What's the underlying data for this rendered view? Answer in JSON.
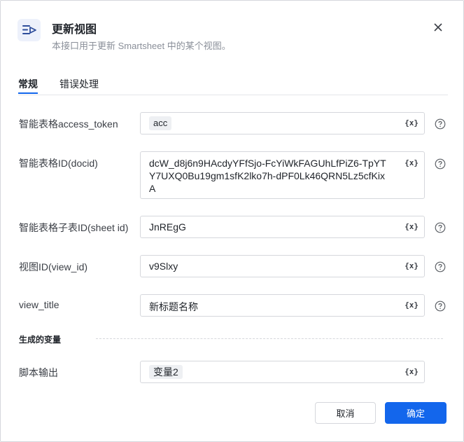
{
  "dialog": {
    "title": "更新视图",
    "subtitle": "本接口用于更新 Smartsheet 中的某个视图。",
    "icon": "smartsheet-view-icon",
    "close_icon": "close-icon"
  },
  "tabs": [
    {
      "label": "常规",
      "active": true
    },
    {
      "label": "错误处理",
      "active": false
    }
  ],
  "fields": {
    "access_token": {
      "label": "智能表格access_token",
      "tag": "acc"
    },
    "docid": {
      "label": "智能表格ID(docid)",
      "value": "dcW_d8j6n9HAcdyYFfSjo-FcYiWkFAGUhLfPiZ6-TpYTY7UXQ0Bu19gm1sfK2lko7h-dPF0Lk46QRN5Lz5cfKixA"
    },
    "sheet_id": {
      "label": "智能表格子表ID(sheet id)",
      "value": "JnREgG"
    },
    "view_id": {
      "label": "视图ID(view_id)",
      "value": "v9Slxy"
    },
    "view_title": {
      "label": "view_title",
      "value": "新标题名称"
    }
  },
  "variable_button": "{x}",
  "output_section": {
    "title": "生成的变量",
    "script_output": {
      "label": "脚本输出",
      "tag": "变量2"
    }
  },
  "buttons": {
    "cancel": "取消",
    "confirm": "确定"
  },
  "colors": {
    "accent": "#1366ec",
    "border": "#d5d7dc",
    "tag_bg": "#eef0f3",
    "muted_text": "#8a8f99"
  }
}
